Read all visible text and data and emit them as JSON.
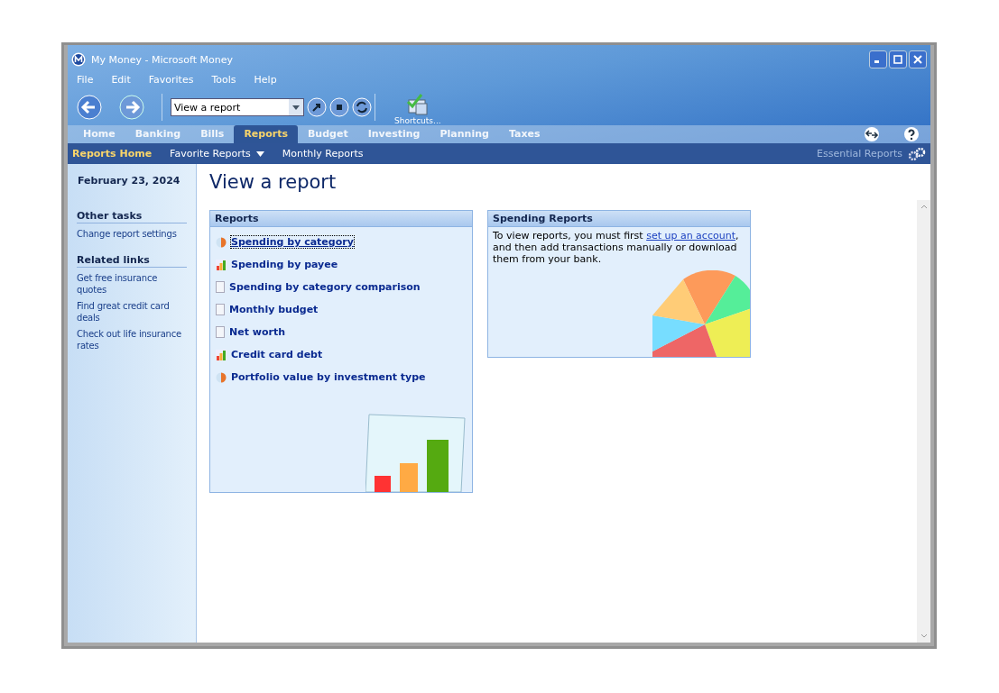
{
  "window": {
    "title": "My Money - Microsoft Money"
  },
  "menu": [
    "File",
    "Edit",
    "Favorites",
    "Tools",
    "Help"
  ],
  "toolbar": {
    "address": "View a report",
    "shortcuts": "Shortcuts..."
  },
  "tabs": [
    {
      "label": "Home",
      "selected": false
    },
    {
      "label": "Banking",
      "selected": false
    },
    {
      "label": "Bills",
      "selected": false
    },
    {
      "label": "Reports",
      "selected": true
    },
    {
      "label": "Budget",
      "selected": false
    },
    {
      "label": "Investing",
      "selected": false
    },
    {
      "label": "Planning",
      "selected": false
    },
    {
      "label": "Taxes",
      "selected": false
    }
  ],
  "subnav": {
    "items": [
      {
        "label": "Reports Home",
        "selected": true,
        "dropdown": false
      },
      {
        "label": "Favorite Reports",
        "selected": false,
        "dropdown": true
      },
      {
        "label": "Monthly Reports",
        "selected": false,
        "dropdown": false
      }
    ],
    "right": "Essential Reports"
  },
  "sidebar": {
    "date": "February 23, 2024",
    "sections": [
      {
        "title": "Other tasks",
        "links": [
          "Change report settings"
        ]
      },
      {
        "title": "Related links",
        "links": [
          "Get free insurance quotes",
          "Find great credit card deals",
          "Check out life insurance rates"
        ]
      }
    ]
  },
  "page_title": "View a report",
  "reports_panel": {
    "title": "Reports",
    "items": [
      {
        "label": "Spending by category",
        "kind": "pie",
        "selected": true
      },
      {
        "label": "Spending by payee",
        "kind": "bar",
        "selected": false
      },
      {
        "label": "Spending by category comparison",
        "kind": "doc",
        "selected": false
      },
      {
        "label": "Monthly budget",
        "kind": "doc",
        "selected": false
      },
      {
        "label": "Net worth",
        "kind": "doc",
        "selected": false
      },
      {
        "label": "Credit card debt",
        "kind": "bar",
        "selected": false
      },
      {
        "label": "Portfolio value by investment type",
        "kind": "pie",
        "selected": false
      }
    ]
  },
  "spending_panel": {
    "title": "Spending Reports",
    "text_before": "To view reports, you must first ",
    "link": "set up an account",
    "text_after": ", and then add transactions manually or download them from your bank."
  }
}
